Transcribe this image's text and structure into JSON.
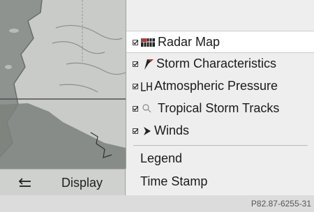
{
  "navigation": {
    "back_icon": "back-arrow-icon",
    "display_label": "Display"
  },
  "map": {
    "icon": "weather-map"
  },
  "menu": {
    "items": [
      {
        "label": "Radar Map",
        "checkbox": true,
        "icon": "radar-map-icon",
        "selected": true
      },
      {
        "label": "Storm Characteristics",
        "checkbox": true,
        "icon": "storm-flag-icon",
        "selected": false
      },
      {
        "label": "Atmospheric Pressure",
        "checkbox": true,
        "icon": "pressure-lh-icon",
        "selected": false
      },
      {
        "label": "Tropical Storm Tracks",
        "checkbox": true,
        "icon": "storm-track-icon",
        "selected": false
      },
      {
        "label": "Winds",
        "checkbox": true,
        "icon": "wind-arrow-icon",
        "selected": false
      },
      {
        "label": "Legend",
        "checkbox": false,
        "selected": false
      },
      {
        "label": "Time Stamp",
        "checkbox": false,
        "selected": false
      }
    ]
  },
  "reference_code": "P82.87-6255-31",
  "colors": {
    "selected_background": "#ffffff",
    "menu_background": "#eeeeee",
    "map_land": "#c8cbc8"
  }
}
